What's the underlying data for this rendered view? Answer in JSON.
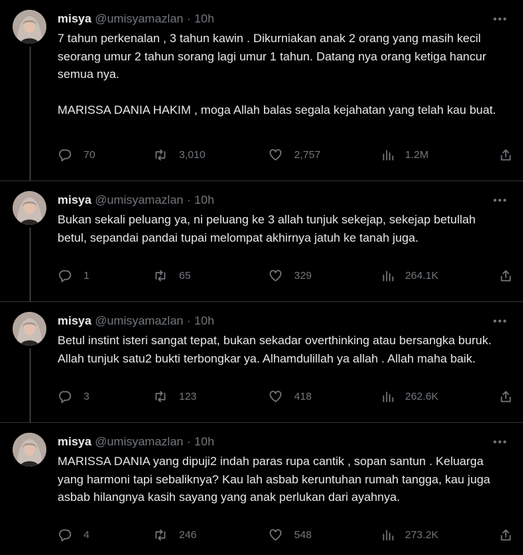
{
  "colors": {
    "background": "#000000",
    "text": "#e7e9ea",
    "muted": "#71767b",
    "divider": "#2f3336"
  },
  "tweets": [
    {
      "name": "misya",
      "handle": "@umisyamazlan",
      "separator": "·",
      "time": "10h",
      "paragraphs": [
        "7 tahun perkenalan , 3 tahun kawin . Dikurniakan anak 2 orang yang masih kecil seorang umur 2 tahun sorang lagi umur 1 tahun. Datang nya orang ketiga hancur semua nya.",
        "MARISSA DANIA HAKIM , moga Allah balas segala kejahatan yang telah kau buat."
      ],
      "replies": "70",
      "retweets": "3,010",
      "likes": "2,757",
      "views": "1.2M"
    },
    {
      "name": "misya",
      "handle": "@umisyamazlan",
      "separator": "·",
      "time": "10h",
      "paragraphs": [
        "Bukan sekali peluang ya, ni peluang ke 3 allah tunjuk sekejap, sekejap betullah betul, sepandai pandai tupai melompat akhirnya jatuh ke tanah juga."
      ],
      "replies": "1",
      "retweets": "65",
      "likes": "329",
      "views": "264.1K"
    },
    {
      "name": "misya",
      "handle": "@umisyamazlan",
      "separator": "·",
      "time": "10h",
      "paragraphs": [
        "Betul instint isteri sangat tepat, bukan sekadar overthinking atau bersangka buruk. Allah tunjuk satu2 bukti terbongkar ya. Alhamdulillah ya allah . Allah maha baik."
      ],
      "replies": "3",
      "retweets": "123",
      "likes": "418",
      "views": "262.6K"
    },
    {
      "name": "misya",
      "handle": "@umisyamazlan",
      "separator": "·",
      "time": "10h",
      "paragraphs": [
        "MARISSA DANIA yang dipuji2 indah paras rupa cantik , sopan santun . Keluarga yang harmoni tapi sebaliknya? Kau lah asbab keruntuhan rumah tangga, kau juga asbab hilangnya kasih sayang yang anak perlukan dari ayahnya."
      ],
      "replies": "4",
      "retweets": "246",
      "likes": "548",
      "views": "273.2K"
    }
  ]
}
